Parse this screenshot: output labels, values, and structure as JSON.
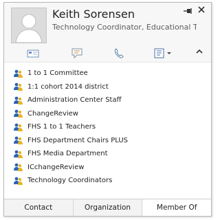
{
  "contact": {
    "name": "Keith Sorensen",
    "title": "Technology Coordinator, Educational Tec..."
  },
  "window_controls": {
    "pin_icon": "pin-icon",
    "close_icon": "close-icon"
  },
  "actions": [
    {
      "icon": "email-icon"
    },
    {
      "icon": "chat-icon"
    },
    {
      "icon": "phone-icon"
    },
    {
      "icon": "contact-card-icon"
    }
  ],
  "member_of": [
    "1 to 1 Committee",
    "1:1 cohort 2014 district",
    "Administration Center Staff",
    "ChangeReview",
    "FHS 1 to 1 Teachers",
    "FHS Department Chairs PLUS",
    "FHS Media Department",
    "ICchangeReview",
    "Technology Coordinators"
  ],
  "tabs": [
    "Contact",
    "Organization",
    "Member Of"
  ],
  "active_tab": "Member Of",
  "colors": {
    "header_bg": "#f7f7f7",
    "group_icon_blue": "#2b63b8",
    "group_icon_yellow": "#e4b627"
  }
}
